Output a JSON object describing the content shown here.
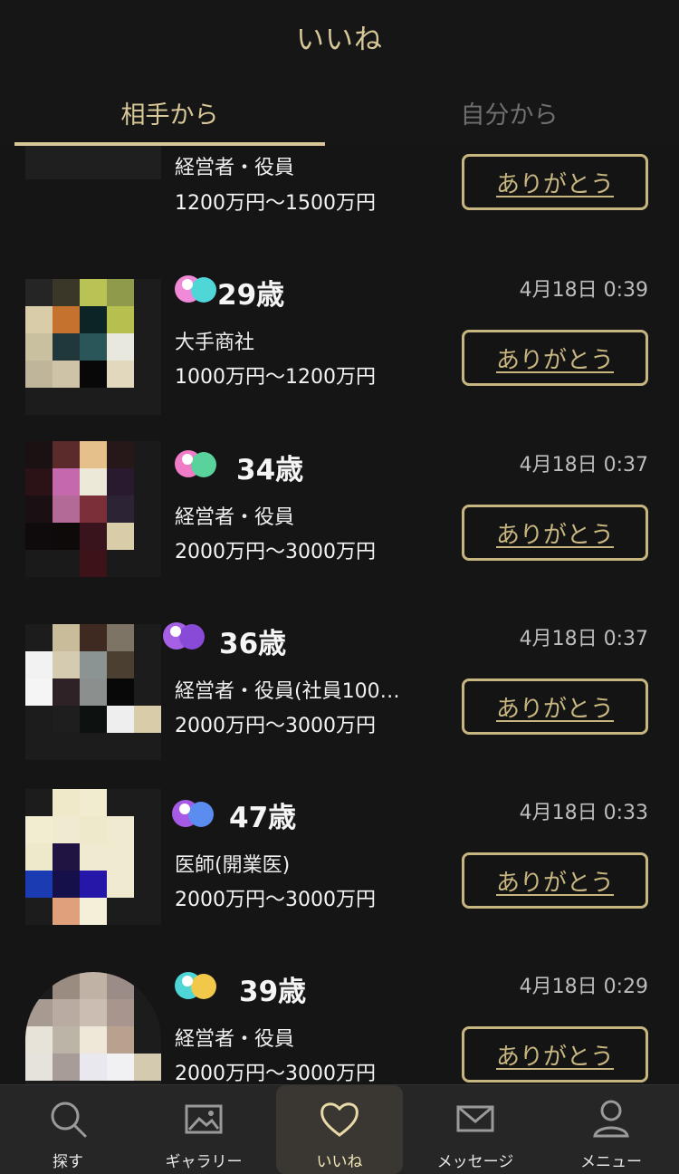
{
  "header": {
    "title": "いいね",
    "tabs": [
      {
        "label": "相手から",
        "active": true
      },
      {
        "label": "自分から",
        "active": false
      }
    ]
  },
  "list": [
    {
      "age": "",
      "date": "",
      "job": "経営者・役員",
      "income": "1200万円〜1500万円",
      "button": "ありがとう",
      "sticker_colors": [],
      "avatar": [
        "#e6e39a",
        "#e8e3a6",
        "#ece8c6",
        "#e8e5a8",
        "#262626",
        "#d9d88a",
        "#e6e2b2",
        "#efefd5",
        "#e9e7bd",
        "#2a2a2a",
        "#2a2a2a",
        "#e0dfa2",
        "#e8e7c6",
        "#e3e0be",
        "#262626",
        "#1f1f1f",
        "#1f1f1f",
        "#1f1f1f",
        "#1f1f1f",
        "#1f1f1f",
        "#1f1f1f",
        "#1f1f1f",
        "#1f1f1f",
        "#1f1f1f",
        "#1f1f1f"
      ]
    },
    {
      "age": "29歳",
      "date": "4月18日 0:39",
      "job": "大手商社",
      "income": "1000万円〜1200万円",
      "button": "ありがとう",
      "sticker_colors": [
        "#f08ad8",
        "#4fd6d6"
      ],
      "avatar": [
        "#252525",
        "#3a3628",
        "#b9c255",
        "#8f9a4a",
        "#1c1c1c",
        "#d8cda8",
        "#c5722f",
        "#0c2426",
        "#b5c04f",
        "#1c1c1c",
        "#c9c0a0",
        "#20383b",
        "#2a5559",
        "#e8e8df",
        "#1c1c1c",
        "#bfb59a",
        "#cfc3a7",
        "#080808",
        "#e2d8bd",
        "#1c1c1c",
        "#1c1c1c",
        "#1c1c1c",
        "#1c1c1c",
        "#1c1c1c",
        "#1c1c1c"
      ]
    },
    {
      "age": "34歳",
      "date": "4月18日 0:37",
      "job": "経営者・役員",
      "income": "2000万円〜3000万円",
      "button": "ありがとう",
      "sticker_colors": [
        "#f07cc8",
        "#5ad29b"
      ],
      "avatar": [
        "#1a1212",
        "#5b2b2c",
        "#e6c08a",
        "#261818",
        "#1a1a1a",
        "#2a1216",
        "#c469ad",
        "#ece9d8",
        "#2a1a2f",
        "#1a1a1a",
        "#1a0f12",
        "#b46a96",
        "#7a2f39",
        "#2c2334",
        "#1a1a1a",
        "#0f0a0c",
        "#0e0a0a",
        "#3a141c",
        "#d8cda8",
        "#1a1a1a",
        "#1a1a1a",
        "#1a1a1a",
        "#3d1218",
        "#1a1a1a",
        "#1a1a1a"
      ]
    },
    {
      "age": "36歳",
      "date": "4月18日 0:37",
      "job": "経営者・役員(社員100…",
      "income": "2000万円〜3000万円",
      "button": "ありがとう",
      "sticker_colors": [
        "#a560e6",
        "#8a4ad8"
      ],
      "avatar": [
        "#1c1c1c",
        "#c8bc9a",
        "#3f2a22",
        "#7d7466",
        "#1c1c1c",
        "#f2f2f2",
        "#d4cbb0",
        "#8b9493",
        "#4a3f31",
        "#1c1c1c",
        "#f5f5f5",
        "#2f2227",
        "#8b8f8d",
        "#080808",
        "#1c1c1c",
        "#1c1c1c",
        "#1e1e1e",
        "#0d1110",
        "#eeeeee",
        "#d8cda8",
        "#1c1c1c",
        "#1c1c1c",
        "#1c1c1c",
        "#1c1c1c",
        "#1c1c1c"
      ]
    },
    {
      "age": "47歳",
      "date": "4月18日 0:33",
      "job": "医師(開業医)",
      "income": "2000万円〜3000万円",
      "button": "ありがとう",
      "sticker_colors": [
        "#a65ae6",
        "#5b8df0"
      ],
      "avatar": [
        "#1c1c1c",
        "#efe9c9",
        "#f1ebd0",
        "#1c1c1c",
        "#1c1c1c",
        "#f2ecd1",
        "#f0ead0",
        "#efe9cc",
        "#f0ead0",
        "#1c1c1c",
        "#efe9cc",
        "#1f1442",
        "#f0ead0",
        "#f0ead0",
        "#1c1c1c",
        "#1a3bb2",
        "#150f4a",
        "#2517a8",
        "#f0ead0",
        "#1c1c1c",
        "#1c1c1c",
        "#e1a07c",
        "#f4efd8",
        "#1c1c1c",
        "#1c1c1c"
      ]
    },
    {
      "age": "39歳",
      "date": "4月18日 0:29",
      "job": "経営者・役員",
      "income": "2000万円〜3000万円",
      "button": "ありがとう",
      "sticker_colors": [
        "#4ed6d6",
        "#f2c84b"
      ],
      "avatar": [
        "#1c1c1c",
        "#9a8c80",
        "#c1b2a6",
        "#9c8c87",
        "#1c1c1c",
        "#a79b91",
        "#b9aaa2",
        "#cbbdb2",
        "#a8958e",
        "#1c1c1c",
        "#e8e3d8",
        "#bcb4a6",
        "#efe8d8",
        "#b8a18e",
        "#1c1c1c",
        "#e6e2dc",
        "#a79c98",
        "#e8e8ee",
        "#f1f1f3",
        "#d4cab0",
        "#1c1c1c",
        "#1c1c1c",
        "#1c1c1c",
        "#1c1c1c",
        "#1c1c1c"
      ]
    }
  ],
  "tabbar": {
    "items": [
      {
        "label": "探す",
        "icon": "search-icon"
      },
      {
        "label": "ギャラリー",
        "icon": "gallery-icon"
      },
      {
        "label": "いいね",
        "icon": "heart-icon",
        "active": true
      },
      {
        "label": "メッセージ",
        "icon": "mail-icon"
      },
      {
        "label": "メニュー",
        "icon": "person-icon"
      }
    ]
  }
}
